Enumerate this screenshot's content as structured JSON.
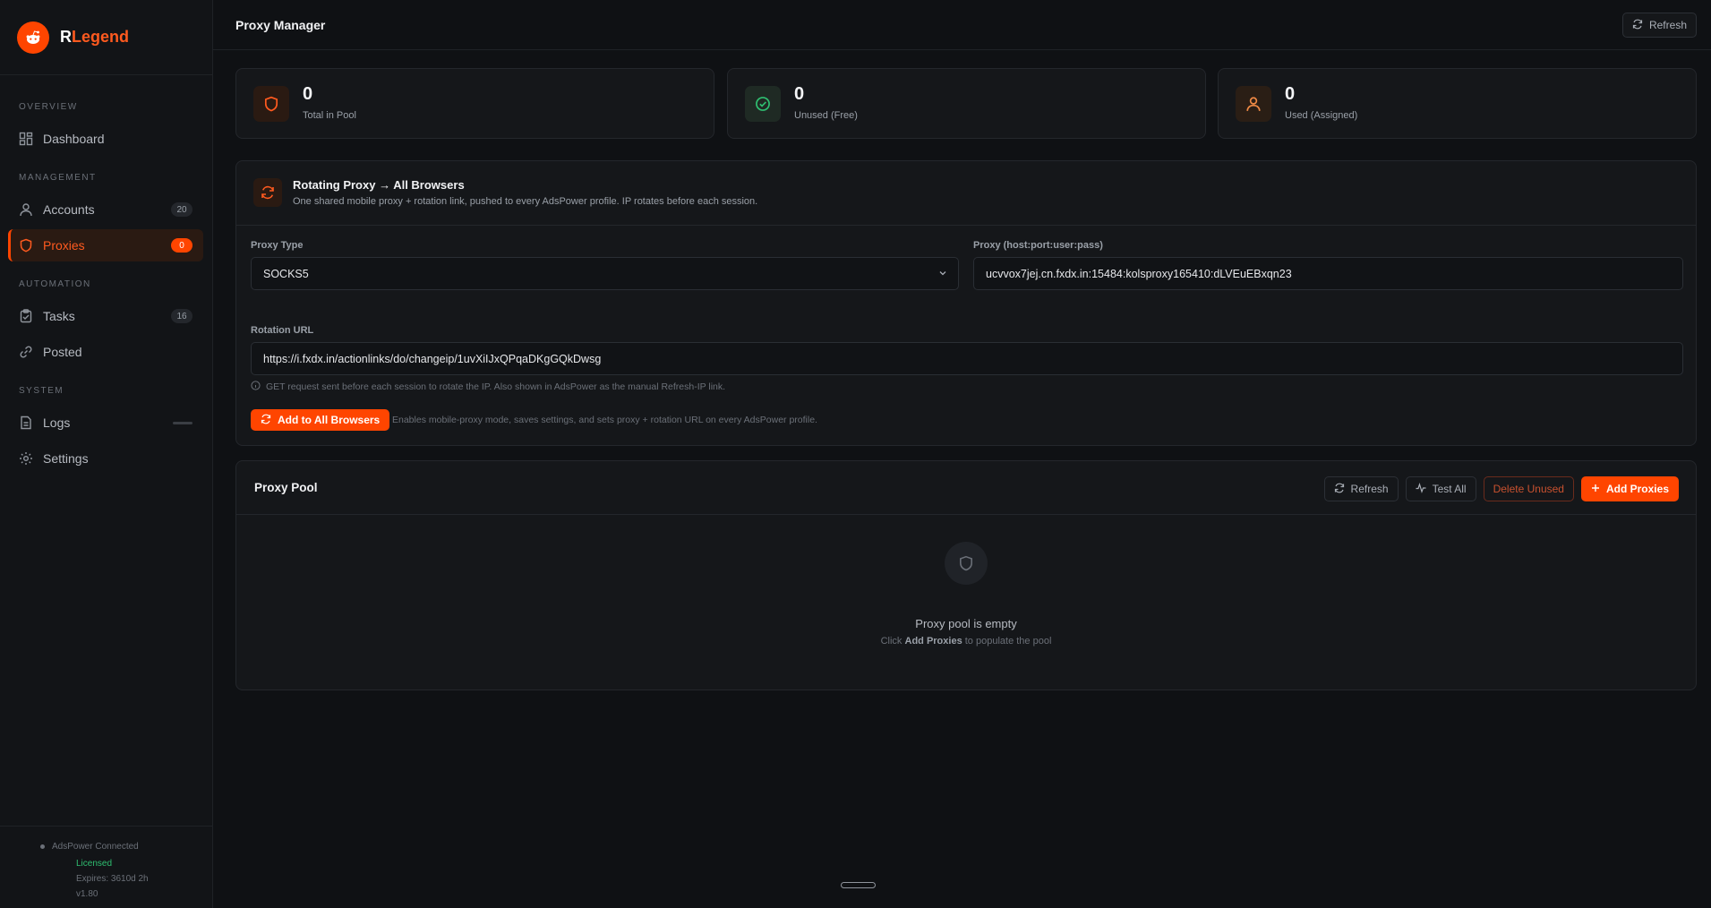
{
  "brand": {
    "name_first": "R",
    "name_rest": "Legend"
  },
  "sidebar": {
    "sections": {
      "overview": "OVERVIEW",
      "management": "MANAGEMENT",
      "automation": "AUTOMATION",
      "system": "SYSTEM"
    },
    "items": {
      "dashboard": {
        "label": "Dashboard"
      },
      "accounts": {
        "label": "Accounts",
        "badge": "20"
      },
      "proxies": {
        "label": "Proxies",
        "badge": "0"
      },
      "tasks": {
        "label": "Tasks",
        "badge": "16"
      },
      "posted": {
        "label": "Posted"
      },
      "logs": {
        "label": "Logs"
      },
      "settings": {
        "label": "Settings"
      }
    },
    "footer": {
      "adspower": "AdsPower Connected",
      "license": "Licensed",
      "expires": "Expires: 3610d 2h",
      "version": "v1.80"
    }
  },
  "header": {
    "title": "Proxy Manager",
    "refresh_label": "Refresh"
  },
  "stats": {
    "total": {
      "value": "0",
      "label": "Total in Pool"
    },
    "unused": {
      "value": "0",
      "label": "Unused (Free)"
    },
    "used": {
      "value": "0",
      "label": "Used (Assigned)"
    }
  },
  "rotating": {
    "title": "Rotating Proxy → All Browsers",
    "subtitle": "One shared mobile proxy + rotation link, pushed to every AdsPower profile. IP rotates before each session.",
    "proxy_type_label": "Proxy Type",
    "proxy_type_value": "SOCKS5",
    "proxy_label": "Proxy (host:port:user:pass)",
    "proxy_value": "ucvvox7jej.cn.fxdx.in:15484:kolsproxy165410:dLVEuEBxqn23",
    "rotation_label": "Rotation URL",
    "rotation_value": "https://i.fxdx.in/actionlinks/do/changeip/1uvXiIJxQPqaDKgGQkDwsg",
    "rotation_hint": "GET request sent before each session to rotate the IP. Also shown in AdsPower as the manual Refresh-IP link.",
    "apply_label": "Add to All Browsers",
    "apply_hint": "Enables mobile-proxy mode, saves settings, and sets proxy + rotation URL on every AdsPower profile."
  },
  "pool": {
    "title": "Proxy Pool",
    "refresh_label": "Refresh",
    "test_label": "Test All",
    "delete_label": "Delete Unused",
    "add_label": "Add Proxies",
    "empty_title": "Proxy pool is empty",
    "empty_prefix": "Click",
    "empty_strong": "Add Proxies",
    "empty_suffix": "to populate the pool"
  },
  "colors": {
    "accent": "#ff4500",
    "success": "#2fbf71",
    "background": "#0f1114",
    "card": "#15171a"
  }
}
